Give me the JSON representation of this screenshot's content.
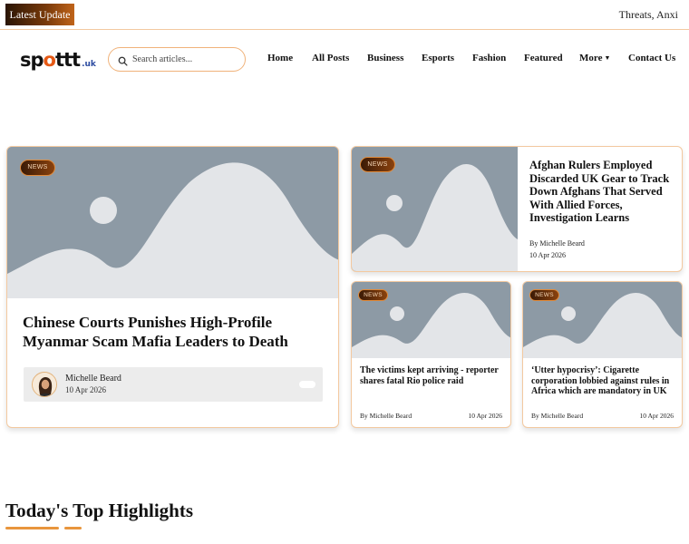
{
  "ticker": {
    "badge": "Latest Update",
    "text": "Threats, Anxi"
  },
  "header": {
    "logo": {
      "main_prefix": "sp",
      "main_o": "o",
      "main_suffix": "ttt",
      "suffix": ".uk"
    },
    "search": {
      "placeholder": "Search articles..."
    },
    "nav": [
      {
        "label": "Home"
      },
      {
        "label": "All Posts"
      },
      {
        "label": "Business"
      },
      {
        "label": "Esports"
      },
      {
        "label": "Fashion"
      },
      {
        "label": "Featured"
      },
      {
        "label": "More"
      },
      {
        "label": "Contact Us"
      }
    ]
  },
  "featured": {
    "tag": "NEWS",
    "title": "Chinese Courts Punishes High-Profile Myanmar Scam Mafia Leaders to Death",
    "author": "Michelle Beard",
    "date": "10 Apr 2026"
  },
  "side_top": {
    "tag": "NEWS",
    "title": "Afghan Rulers Employed Discarded UK Gear to Track Down Afghans That Served With Allied Forces, Investigation Learns",
    "author": "By Michelle Beard",
    "date": "10 Apr 2026"
  },
  "small_cards": [
    {
      "tag": "NEWS",
      "title": "The victims kept arriving - reporter shares fatal Rio police raid",
      "author": "By Michelle Beard",
      "date": "10 Apr 2026"
    },
    {
      "tag": "NEWS",
      "title": "‘Utter hypocrisy’: Cigarette corporation lobbied against rules in Africa which are mandatory in UK",
      "author": "By Michelle Beard",
      "date": "10 Apr 2026"
    }
  ],
  "section": {
    "title": "Today's Top Highlights"
  },
  "colors": {
    "accent": "#e8963d",
    "border": "#f3c9a0",
    "placeholder_bg": "#8d9aa5",
    "placeholder_fg": "#e3e5e8",
    "tag_dark": "#3a1a06"
  }
}
